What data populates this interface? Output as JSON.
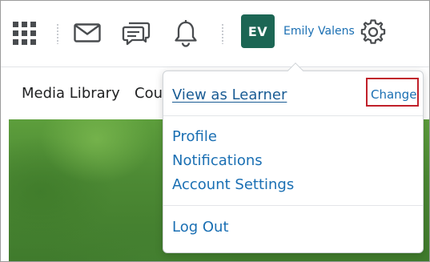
{
  "topbar": {
    "icons": {
      "apps": "grid-icon",
      "mail": "envelope-icon",
      "chat": "chat-bubbles-icon",
      "notifications": "bell-icon",
      "settings": "gear-icon"
    },
    "avatar_initials": "EV",
    "user_name": "Emily Valens"
  },
  "nav": {
    "items": [
      "Media Library",
      "Cou"
    ]
  },
  "dropdown": {
    "view_as_learner": "View as Learner",
    "change": "Change",
    "profile": "Profile",
    "notifications": "Notifications",
    "account_settings": "Account Settings",
    "log_out": "Log Out"
  },
  "colors": {
    "link": "#1a6fb3",
    "avatar_bg": "#1c6654",
    "highlight_box": "#c0202a"
  }
}
